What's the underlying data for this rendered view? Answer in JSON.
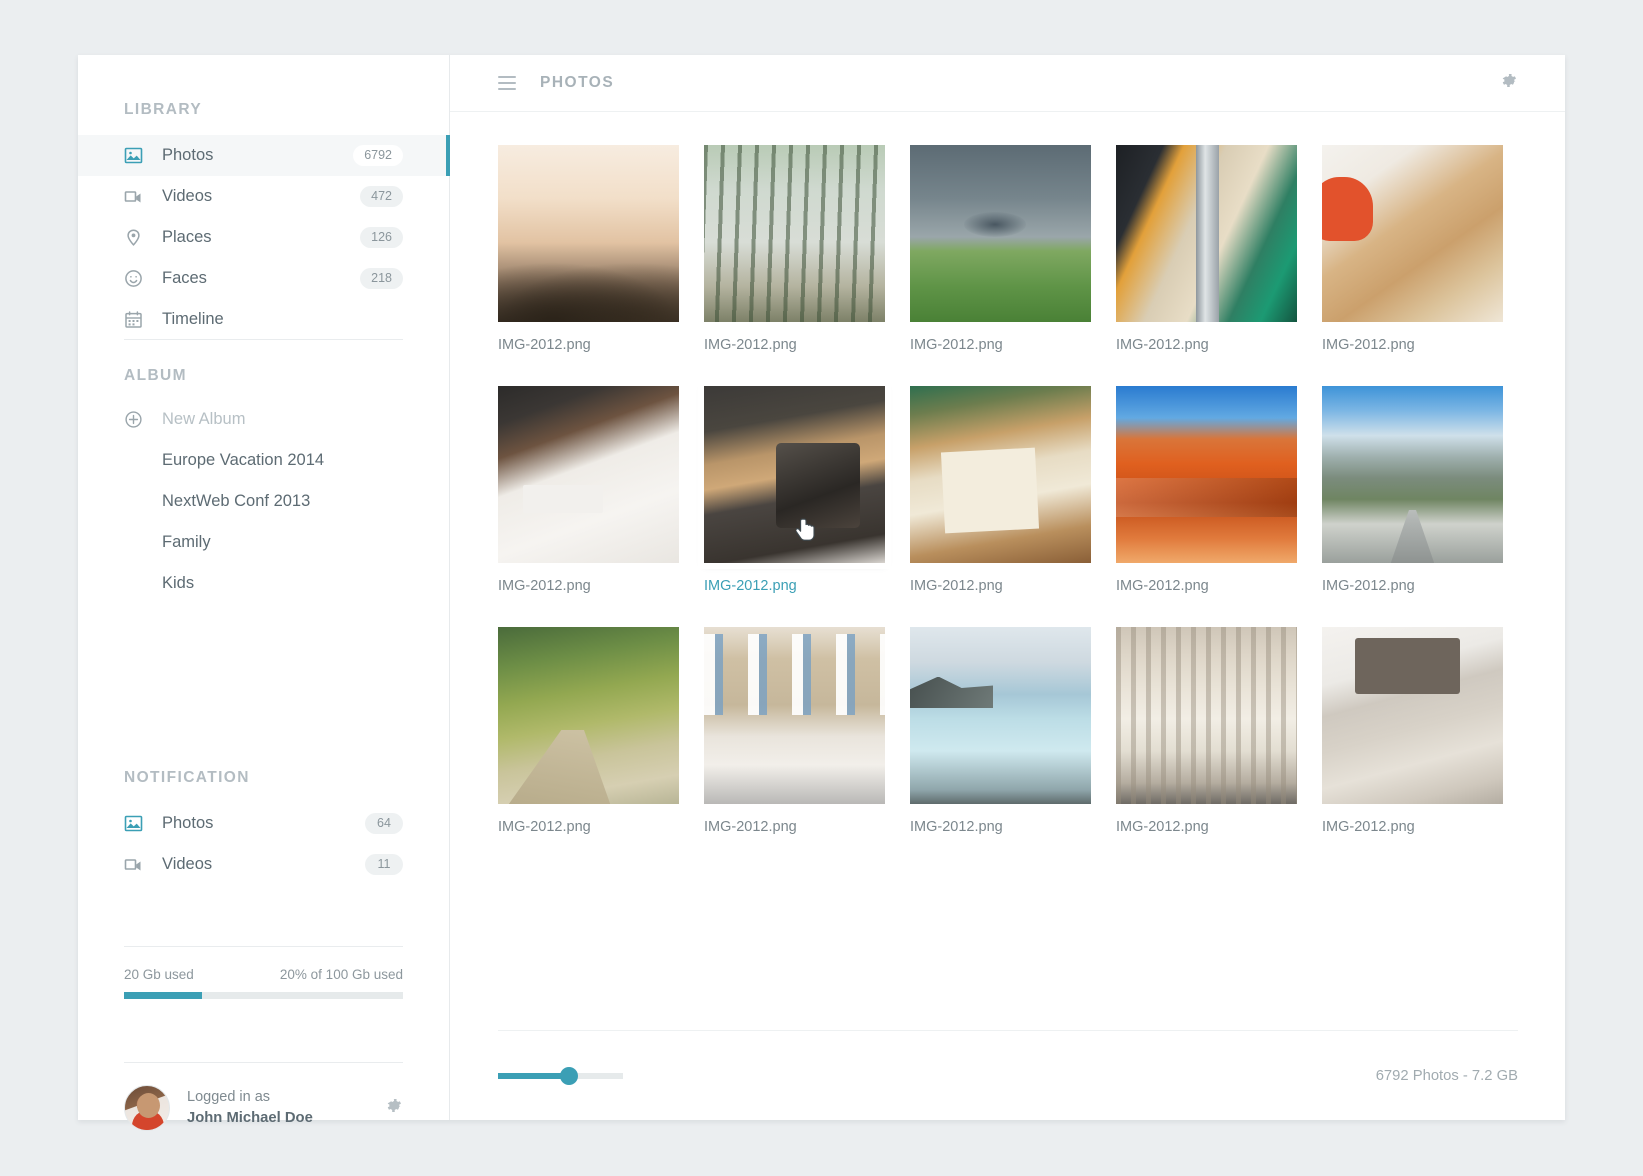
{
  "theme": {
    "accent": "#3b9fb5",
    "text": "#5d6b73",
    "muted": "#a8b2b8",
    "page_bg": "#ebeef0"
  },
  "sidebar": {
    "library": {
      "title": "LIBRARY",
      "items": [
        {
          "label": "Photos",
          "badge": "6792",
          "icon": "image-icon",
          "active": true
        },
        {
          "label": "Videos",
          "badge": "472",
          "icon": "video-icon",
          "active": false
        },
        {
          "label": "Places",
          "badge": "126",
          "icon": "pin-icon",
          "active": false
        },
        {
          "label": "Faces",
          "badge": "218",
          "icon": "smiley-icon",
          "active": false
        },
        {
          "label": "Timeline",
          "badge": "",
          "icon": "calendar-icon",
          "active": false
        }
      ]
    },
    "album": {
      "title": "ALBUM",
      "new_album_label": "New Album",
      "items": [
        {
          "label": "Europe Vacation 2014"
        },
        {
          "label": "NextWeb Conf 2013"
        },
        {
          "label": "Family"
        },
        {
          "label": "Kids"
        }
      ]
    },
    "notification": {
      "title": "NOTIFICATION",
      "items": [
        {
          "label": "Photos",
          "badge": "64",
          "icon": "image-icon"
        },
        {
          "label": "Videos",
          "badge": "11",
          "icon": "video-icon"
        }
      ]
    },
    "storage": {
      "used_label": "20 Gb used",
      "percent_label": "20% of 100 Gb used",
      "fill_percent": 28
    },
    "user": {
      "logged_in_label": "Logged in as",
      "name": "John Michael Doe",
      "settings_icon": "gear-icon"
    }
  },
  "header": {
    "menu_icon": "hamburger-icon",
    "title": "PHOTOS",
    "settings_icon": "gear-icon"
  },
  "gallery": {
    "items": [
      {
        "caption": "IMG-2012.png",
        "art": "t-mist",
        "selected": false
      },
      {
        "caption": "IMG-2012.png",
        "art": "t-forest",
        "selected": false
      },
      {
        "caption": "IMG-2012.png",
        "art": "t-storm",
        "selected": false
      },
      {
        "caption": "IMG-2012.png",
        "art": "t-hangers",
        "selected": false
      },
      {
        "caption": "IMG-2012.png",
        "art": "t-desk",
        "selected": false
      },
      {
        "caption": "IMG-2012.png",
        "art": "t-deskdark",
        "selected": false
      },
      {
        "caption": "IMG-2012.png",
        "art": "t-cameras",
        "selected": true
      },
      {
        "caption": "IMG-2012.png",
        "art": "t-book",
        "selected": false
      },
      {
        "caption": "IMG-2012.png",
        "art": "t-dune",
        "selected": false
      },
      {
        "caption": "IMG-2012.png",
        "art": "t-road",
        "selected": false
      },
      {
        "caption": "IMG-2012.png",
        "art": "t-path",
        "selected": false
      },
      {
        "caption": "IMG-2012.png",
        "art": "t-house",
        "selected": false
      },
      {
        "caption": "IMG-2012.png",
        "art": "t-lagoon",
        "selected": false
      },
      {
        "caption": "IMG-2012.png",
        "art": "t-church",
        "selected": false
      },
      {
        "caption": "IMG-2012.png",
        "art": "t-laptop",
        "selected": false
      }
    ]
  },
  "footer": {
    "zoom_percent": 57,
    "stats": "6792 Photos - 7.2 GB"
  }
}
